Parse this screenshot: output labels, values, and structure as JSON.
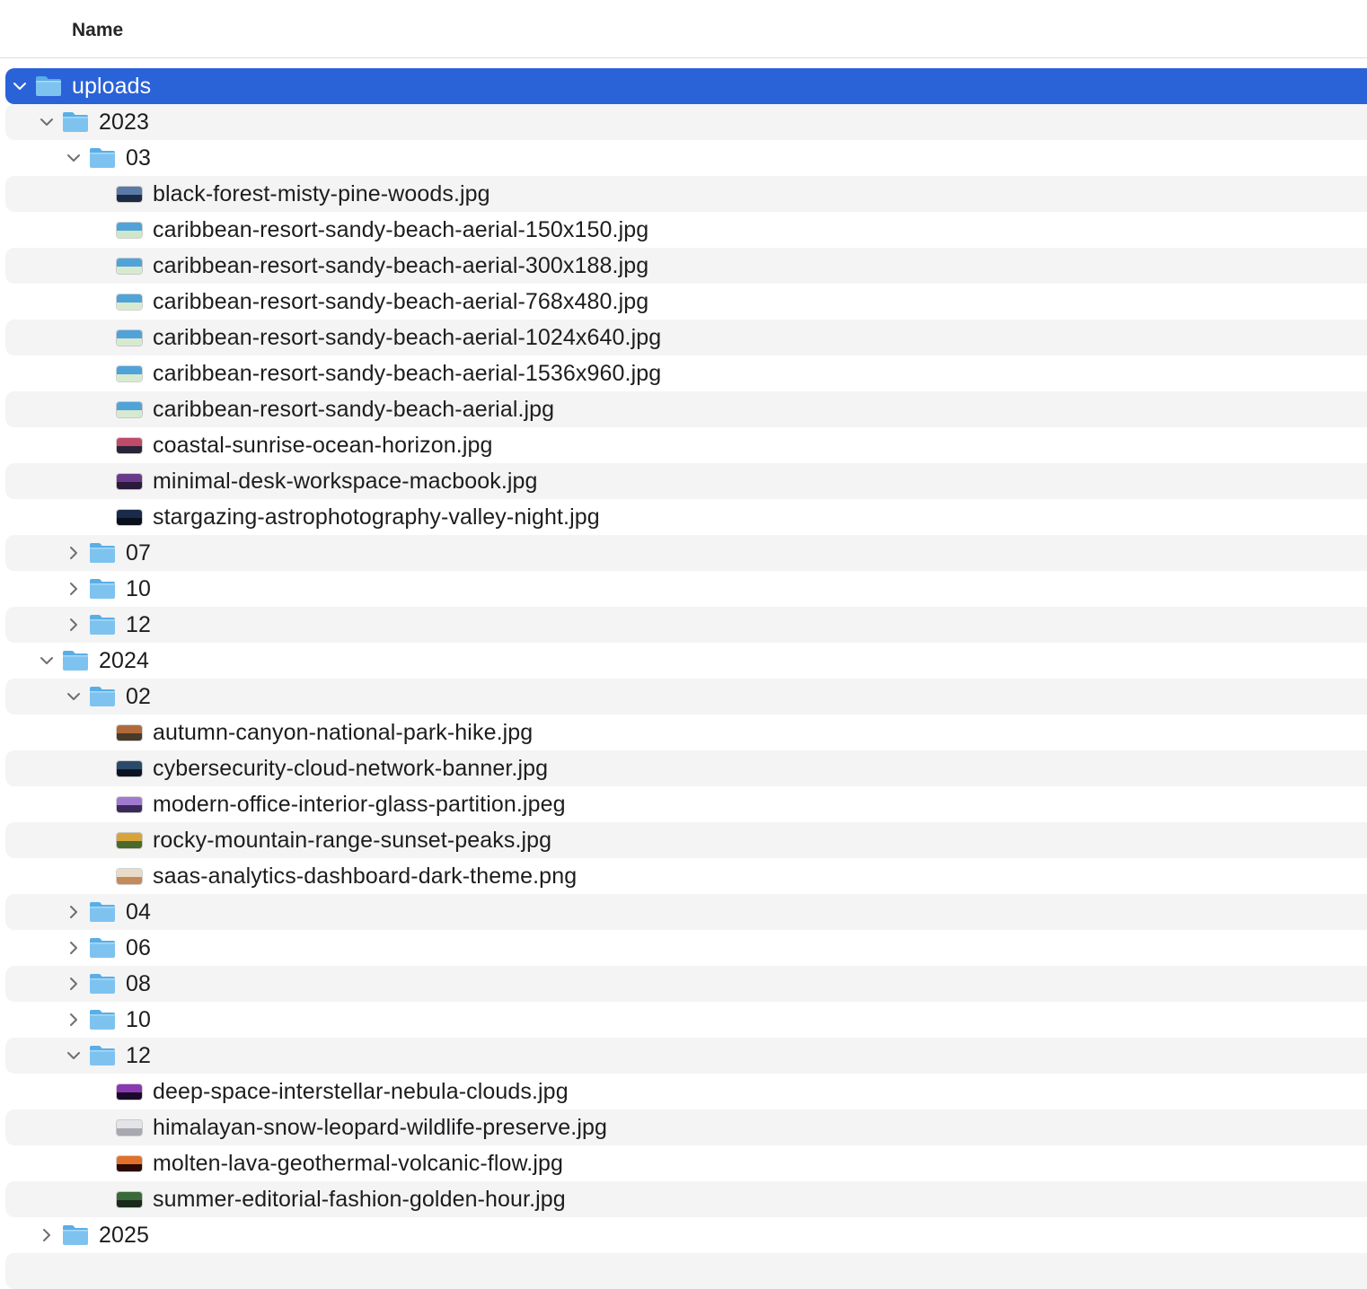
{
  "header": {
    "name_label": "Name"
  },
  "colors": {
    "selection": "#2a62d8",
    "alt_row": "#f4f4f5",
    "folder_body": "#7ec3f0",
    "folder_tab": "#5aaee6"
  },
  "rows": [
    {
      "kind": "folder",
      "depth": 0,
      "expanded": true,
      "selected": true,
      "label": "uploads"
    },
    {
      "kind": "folder",
      "depth": 1,
      "expanded": true,
      "label": "2023"
    },
    {
      "kind": "folder",
      "depth": 2,
      "expanded": true,
      "label": "03"
    },
    {
      "kind": "file",
      "depth": 3,
      "label": "black-forest-misty-pine-woods.jpg",
      "thumb": [
        "#5a7aa8",
        "#1c2a44"
      ]
    },
    {
      "kind": "file",
      "depth": 3,
      "label": "caribbean-resort-sandy-beach-aerial-150x150.jpg",
      "thumb": [
        "#4fa3d9",
        "#cfe6c8"
      ]
    },
    {
      "kind": "file",
      "depth": 3,
      "label": "caribbean-resort-sandy-beach-aerial-300x188.jpg",
      "thumb": [
        "#4fa3d9",
        "#d7ead0"
      ]
    },
    {
      "kind": "file",
      "depth": 3,
      "label": "caribbean-resort-sandy-beach-aerial-768x480.jpg",
      "thumb": [
        "#4fa3d9",
        "#d7ead0"
      ]
    },
    {
      "kind": "file",
      "depth": 3,
      "label": "caribbean-resort-sandy-beach-aerial-1024x640.jpg",
      "thumb": [
        "#4fa3d9",
        "#d7ead0"
      ]
    },
    {
      "kind": "file",
      "depth": 3,
      "label": "caribbean-resort-sandy-beach-aerial-1536x960.jpg",
      "thumb": [
        "#4fa3d9",
        "#d7ead0"
      ]
    },
    {
      "kind": "file",
      "depth": 3,
      "label": "caribbean-resort-sandy-beach-aerial.jpg",
      "thumb": [
        "#4fa3d9",
        "#d7ead0"
      ]
    },
    {
      "kind": "file",
      "depth": 3,
      "label": "coastal-sunrise-ocean-horizon.jpg",
      "thumb": [
        "#c04a6a",
        "#2a2438"
      ]
    },
    {
      "kind": "file",
      "depth": 3,
      "label": "minimal-desk-workspace-macbook.jpg",
      "thumb": [
        "#6a3a8a",
        "#2a1a3a"
      ]
    },
    {
      "kind": "file",
      "depth": 3,
      "label": "stargazing-astrophotography-valley-night.jpg",
      "thumb": [
        "#1a2a4a",
        "#0a0f1c"
      ]
    },
    {
      "kind": "folder",
      "depth": 2,
      "expanded": false,
      "label": "07"
    },
    {
      "kind": "folder",
      "depth": 2,
      "expanded": false,
      "label": "10"
    },
    {
      "kind": "folder",
      "depth": 2,
      "expanded": false,
      "label": "12"
    },
    {
      "kind": "folder",
      "depth": 1,
      "expanded": true,
      "label": "2024"
    },
    {
      "kind": "folder",
      "depth": 2,
      "expanded": true,
      "label": "02"
    },
    {
      "kind": "file",
      "depth": 3,
      "label": "autumn-canyon-national-park-hike.jpg",
      "thumb": [
        "#b06a3a",
        "#4a3a2a"
      ]
    },
    {
      "kind": "file",
      "depth": 3,
      "label": "cybersecurity-cloud-network-banner.jpg",
      "thumb": [
        "#2a4a6a",
        "#0c1424"
      ]
    },
    {
      "kind": "file",
      "depth": 3,
      "label": "modern-office-interior-glass-partition.jpeg",
      "thumb": [
        "#a07ad0",
        "#3a2a5a"
      ]
    },
    {
      "kind": "file",
      "depth": 3,
      "label": "rocky-mountain-range-sunset-peaks.jpg",
      "thumb": [
        "#d8a43a",
        "#4a6a2a"
      ]
    },
    {
      "kind": "file",
      "depth": 3,
      "label": "saas-analytics-dashboard-dark-theme.png",
      "thumb": [
        "#e8dcc8",
        "#c48a5a"
      ]
    },
    {
      "kind": "folder",
      "depth": 2,
      "expanded": false,
      "label": "04"
    },
    {
      "kind": "folder",
      "depth": 2,
      "expanded": false,
      "label": "06"
    },
    {
      "kind": "folder",
      "depth": 2,
      "expanded": false,
      "label": "08"
    },
    {
      "kind": "folder",
      "depth": 2,
      "expanded": false,
      "label": "10"
    },
    {
      "kind": "folder",
      "depth": 2,
      "expanded": true,
      "label": "12"
    },
    {
      "kind": "file",
      "depth": 3,
      "label": "deep-space-interstellar-nebula-clouds.jpg",
      "thumb": [
        "#8a3ab0",
        "#1a0a2a"
      ]
    },
    {
      "kind": "file",
      "depth": 3,
      "label": "himalayan-snow-leopard-wildlife-preserve.jpg",
      "thumb": [
        "#e4e4e8",
        "#a8a8b0"
      ]
    },
    {
      "kind": "file",
      "depth": 3,
      "label": "molten-lava-geothermal-volcanic-flow.jpg",
      "thumb": [
        "#e0702a",
        "#2a0a06"
      ]
    },
    {
      "kind": "file",
      "depth": 3,
      "label": "summer-editorial-fashion-golden-hour.jpg",
      "thumb": [
        "#3a6a3a",
        "#1a2a1a"
      ]
    },
    {
      "kind": "folder",
      "depth": 1,
      "expanded": false,
      "label": "2025"
    }
  ]
}
